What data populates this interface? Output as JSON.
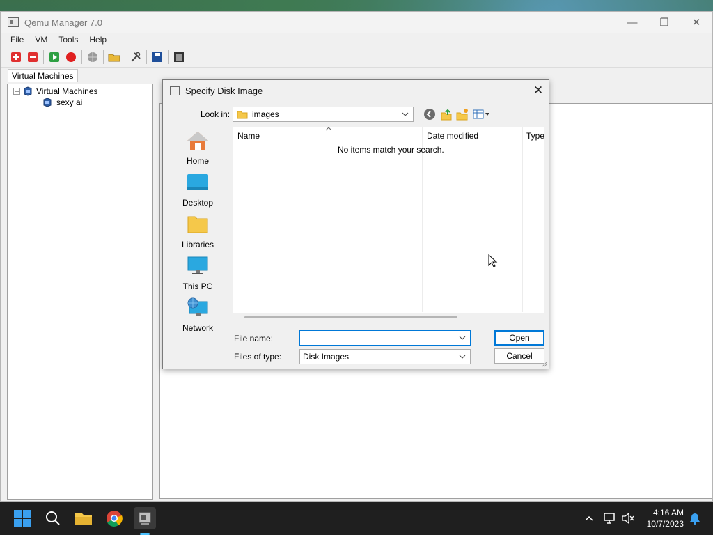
{
  "main_window": {
    "title": "Qemu Manager 7.0",
    "controls": {
      "minimize": "—",
      "restore": "❐",
      "close": "✕"
    },
    "menu": [
      "File",
      "VM",
      "Tools",
      "Help"
    ],
    "tab_label": "Virtual Machines",
    "tree": {
      "root": "Virtual Machines",
      "child": "sexy ai"
    }
  },
  "dialog": {
    "title": "Specify Disk Image",
    "look_in_label": "Look in:",
    "look_in_value": "images",
    "places": [
      "Home",
      "Desktop",
      "Libraries",
      "This PC",
      "Network"
    ],
    "columns": [
      "Name",
      "Date modified",
      "Type"
    ],
    "empty_message": "No items match your search.",
    "file_name_label": "File name:",
    "file_name_value": "",
    "file_type_label": "Files of type:",
    "file_type_value": "Disk Images",
    "open_label": "Open",
    "cancel_label": "Cancel",
    "close_glyph": "✕"
  },
  "taskbar": {
    "time": "4:16 AM",
    "date": "10/7/2023"
  },
  "colors": {
    "accent": "#0078d7",
    "taskbar_bg": "#1f1f1f"
  }
}
